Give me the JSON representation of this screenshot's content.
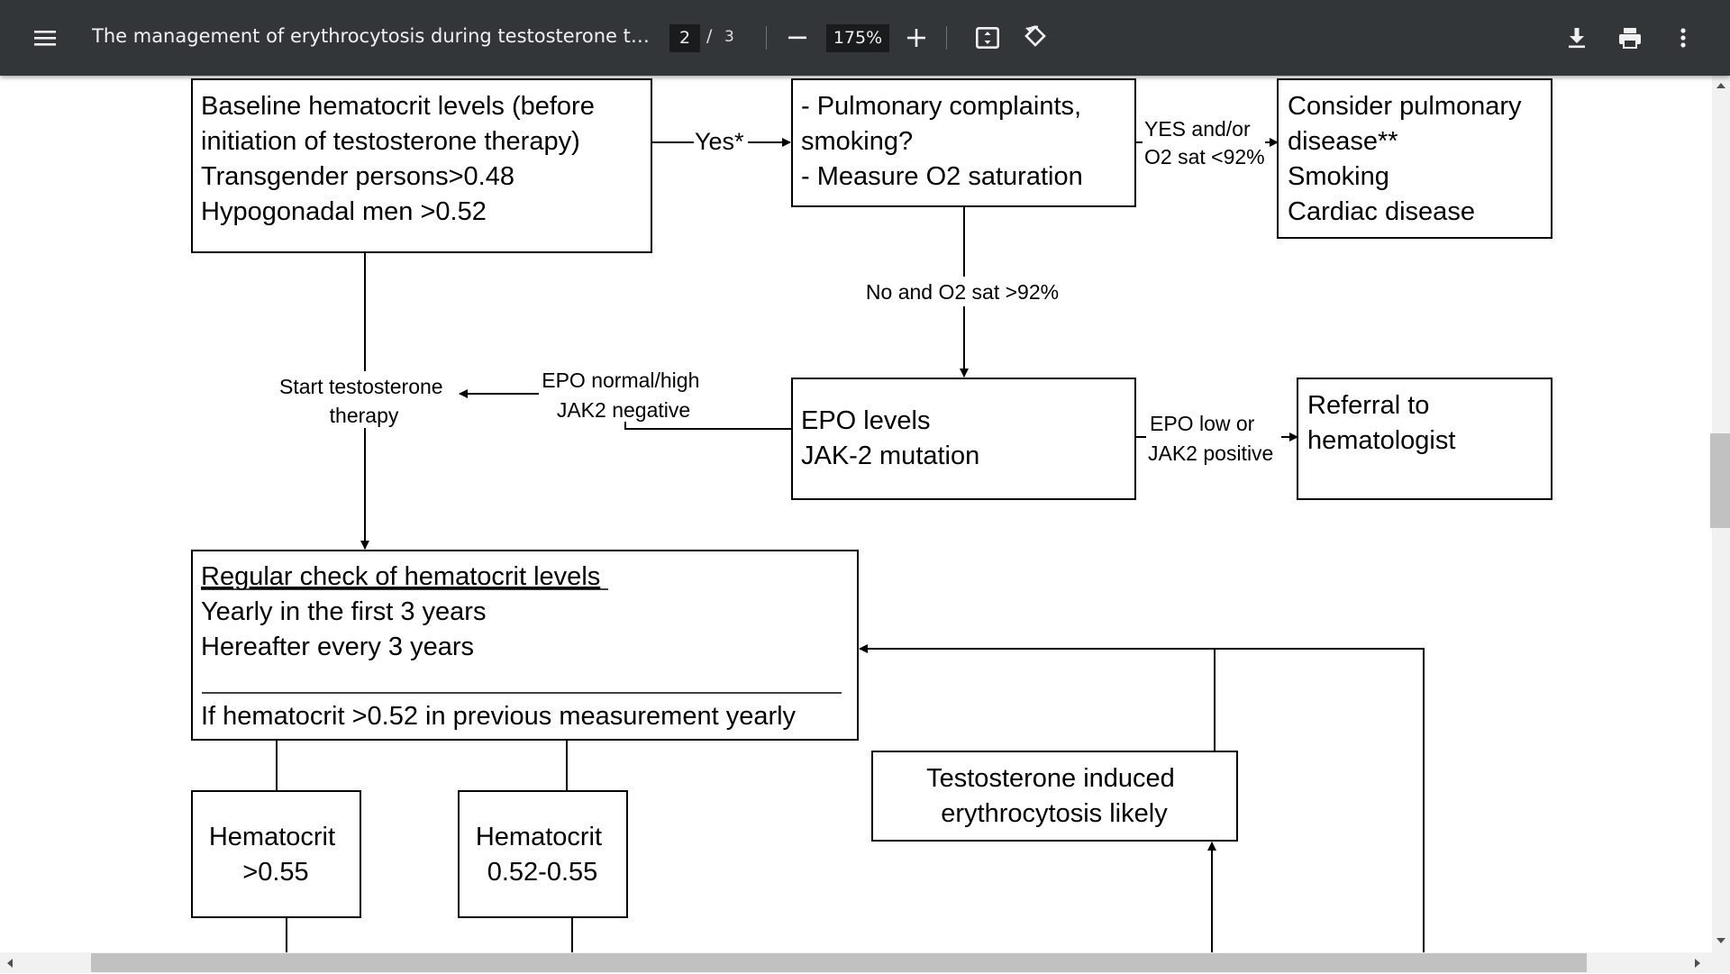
{
  "toolbar": {
    "title": "The management of erythrocytosis during testosterone therap...",
    "page_current": "2",
    "page_separator": "/",
    "page_total": "3",
    "zoom": "175%",
    "icons": [
      "menu-icon",
      "zoom-out-icon",
      "zoom-in-icon",
      "fit-page-icon",
      "rotate-icon",
      "download-icon",
      "print-icon",
      "more-options-icon"
    ]
  },
  "flowchart": {
    "baseline_box": [
      "Baseline hematocrit levels (before",
      "initiation of testosterone therapy)",
      "Transgender persons>0.48",
      "Hypogonadal men >0.52"
    ],
    "yes_label": "Yes*",
    "pulmonary_box": [
      "- Pulmonary complaints,",
      "smoking?",
      "- Measure O2 saturation"
    ],
    "yes_o2_label": [
      "YES and/or",
      "O2 sat <92%"
    ],
    "consider_box": [
      "Consider pulmonary",
      "disease**",
      "Smoking",
      "Cardiac disease"
    ],
    "no_o2_label": "No and O2 sat >92%",
    "start_label": [
      "Start testosterone",
      "therapy"
    ],
    "epo_normal_label": [
      "EPO normal/high",
      "JAK2 negative"
    ],
    "epo_box": [
      "EPO levels",
      "JAK-2 mutation"
    ],
    "epo_low_label": [
      "EPO low or",
      "JAK2 positive"
    ],
    "referral_box": [
      "Referral to",
      "hematologist"
    ],
    "regular_title": "Regular check of hematocrit levels",
    "regular_lines": [
      "Yearly in the first 3 years",
      "Hereafter every 3 years"
    ],
    "regular_if": "If hematocrit >0.52 in previous measurement yearly",
    "hct_high_box": [
      "Hematocrit",
      ">0.55"
    ],
    "hct_mid_box": [
      "Hematocrit",
      "0.52-0.55"
    ],
    "testo_box": [
      "Testosterone induced",
      "erythrocytosis likely"
    ]
  },
  "colors": {
    "toolbar_bg": "#323639",
    "toolbar_text": "#f1f1f1",
    "page_bg": "#ffffff"
  }
}
